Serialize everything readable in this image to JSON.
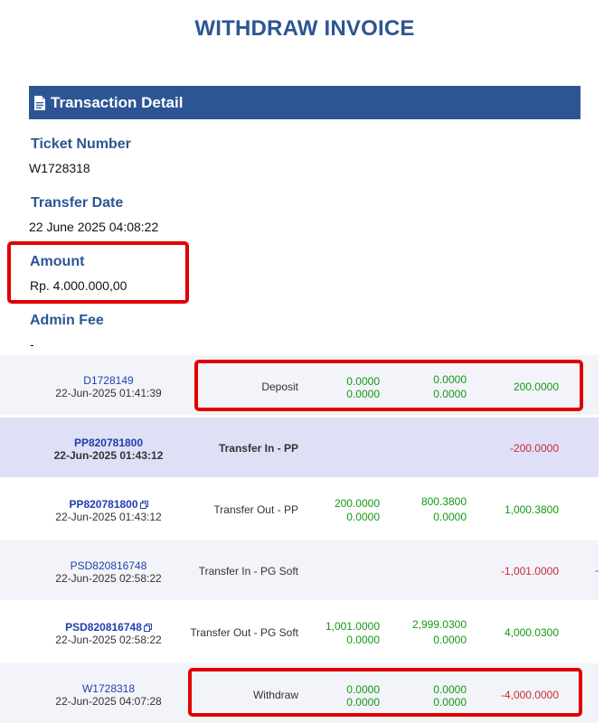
{
  "page": {
    "title": "WITHDRAW INVOICE"
  },
  "section": {
    "title": "Transaction Detail",
    "icon": "document-icon"
  },
  "fields": {
    "ticket_label": "Ticket Number",
    "ticket_value": "W1728318",
    "date_label": "Transfer Date",
    "date_value": "22 June 2025 04:08:22",
    "amount_label": "Amount",
    "amount_value": "Rp. 4.000.000,00",
    "fee_label": "Admin Fee",
    "fee_value": "-"
  },
  "colors": {
    "primary": "#2d5594",
    "highlight": "#e10000",
    "positive": "#129a12",
    "negative": "#c82a32",
    "link": "#1f3fae"
  },
  "transactions": [
    {
      "id": "D1728149",
      "datetime": "22-Jun-2025 01:41:39",
      "type": "Deposit",
      "a1": "0.0000",
      "a2": "0.0000",
      "b1": "0.0000",
      "b2": "0.0000",
      "total": "200.0000"
    },
    {
      "id": "PP820781800",
      "datetime": "22-Jun-2025 01:43:12",
      "type": "Transfer In - PP",
      "total": "-200.0000"
    },
    {
      "id": "PP820781800",
      "datetime": "22-Jun-2025 01:43:12",
      "type": "Transfer Out - PP",
      "a1": "200.0000",
      "a2": "0.0000",
      "b1": "800.3800",
      "b2": "0.0000",
      "total": "1,000.3800"
    },
    {
      "id": "PSD820816748",
      "datetime": "22-Jun-2025 02:58:22",
      "type": "Transfer In - PG Soft",
      "total": "-1,001.0000",
      "trailing": "-"
    },
    {
      "id": "PSD820816748",
      "datetime": "22-Jun-2025 02:58:22",
      "type": "Transfer Out - PG Soft",
      "a1": "1,001.0000",
      "a2": "0.0000",
      "b1": "2,999.0300",
      "b2": "0.0000",
      "total": "4,000.0300"
    },
    {
      "id": "W1728318",
      "datetime": "22-Jun-2025 04:07:28",
      "type": "Withdraw",
      "a1": "0.0000",
      "a2": "0.0000",
      "b1": "0.0000",
      "b2": "0.0000",
      "total": "-4,000.0000"
    }
  ]
}
